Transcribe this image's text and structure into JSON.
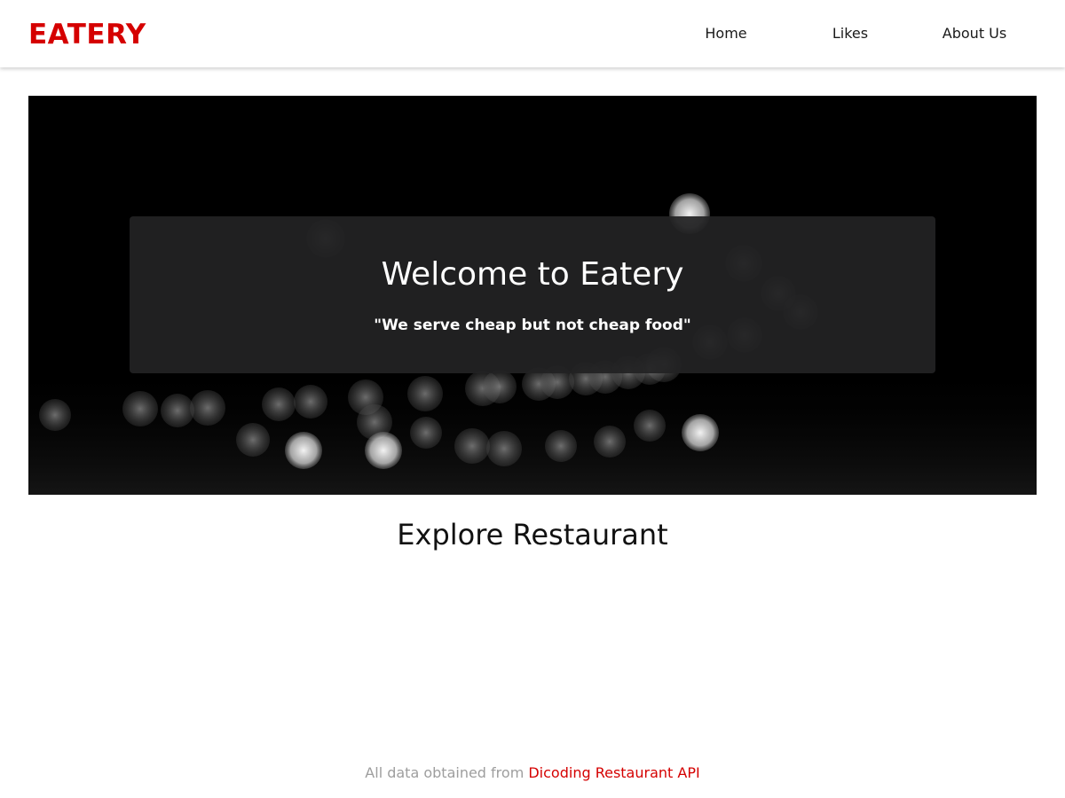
{
  "header": {
    "brand": "EATERY",
    "nav": [
      {
        "label": "Home"
      },
      {
        "label": "Likes"
      },
      {
        "label": "About Us"
      }
    ]
  },
  "hero": {
    "title": "Welcome to Eatery",
    "tagline": "\"We serve cheap but not cheap food\""
  },
  "main": {
    "section_title": "Explore Restaurant"
  },
  "footer": {
    "prefix": "All data obtained from ",
    "link_label": "Dicoding Restaurant API"
  },
  "colors": {
    "brand": "#d50000",
    "footer_text": "#9e9e9e",
    "hero_background": "#000000"
  }
}
